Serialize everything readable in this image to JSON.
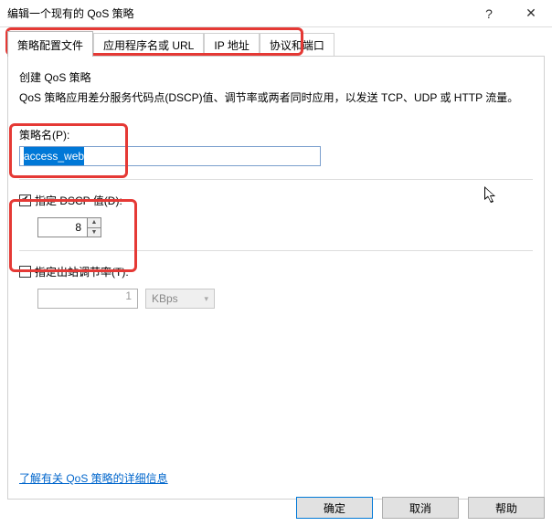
{
  "window": {
    "title": "编辑一个现有的 QoS 策略"
  },
  "tabs": {
    "t0": "策略配置文件",
    "t1": "应用程序名或 URL",
    "t2": "IP 地址",
    "t3": "协议和端口"
  },
  "section": {
    "title": "创建 QoS 策略",
    "desc": "QoS 策略应用差分服务代码点(DSCP)值、调节率或两者同时应用，以发送 TCP、UDP 或 HTTP 流量。"
  },
  "policy_name": {
    "label": "策略名(P):",
    "value": "access_web"
  },
  "dscp": {
    "label": "指定 DSCP 值(D):",
    "value": "8"
  },
  "rate": {
    "label": "指定出站调节率(T):",
    "value": "1",
    "unit": "KBps"
  },
  "link": {
    "text": "了解有关 QoS 策略的详细信息"
  },
  "buttons": {
    "ok": "确定",
    "cancel": "取消",
    "help": "帮助"
  }
}
